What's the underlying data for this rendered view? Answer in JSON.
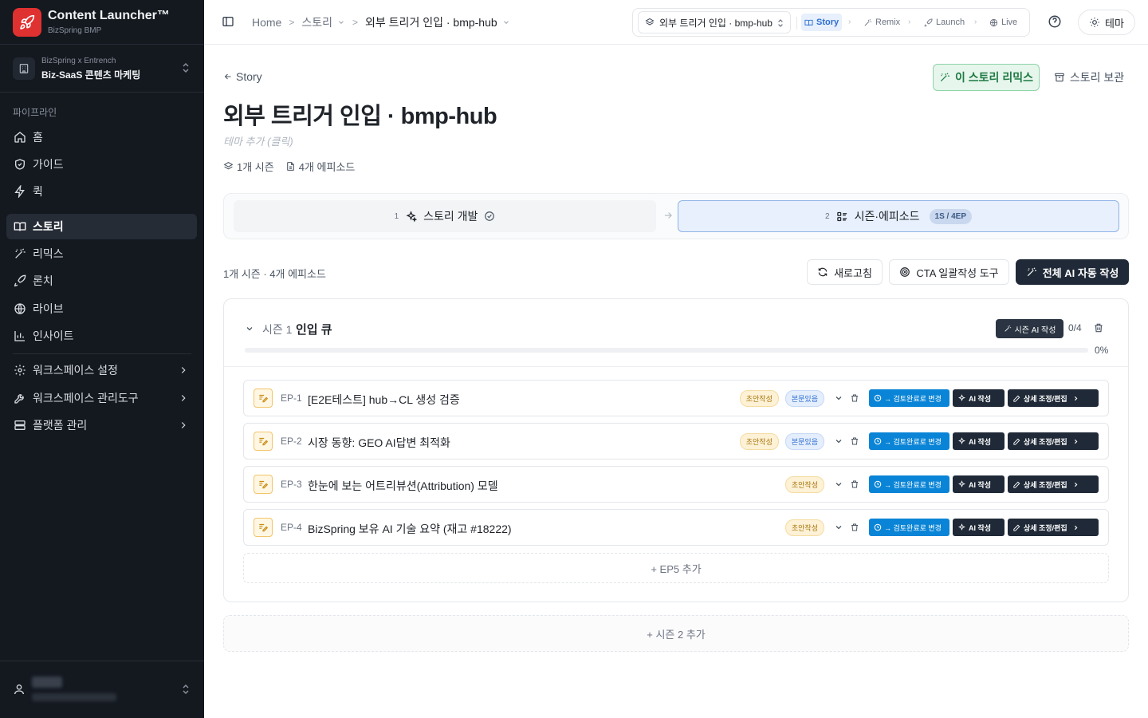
{
  "app": {
    "brand_title": "Content Launcher™",
    "brand_subtitle": "BizSpring BMP"
  },
  "workspace": {
    "label": "BizSpring x Entrench",
    "name": "Biz-SaaS 콘텐츠 마케팅"
  },
  "sidebar": {
    "section_label": "파이프라인",
    "items": [
      {
        "label": "홈",
        "icon": "home-icon"
      },
      {
        "label": "가이드",
        "icon": "shield-icon"
      },
      {
        "label": "퀵",
        "icon": "zap-icon"
      },
      {
        "label": "스토리",
        "icon": "book-icon",
        "active": true
      },
      {
        "label": "리믹스",
        "icon": "magic-wand-icon"
      },
      {
        "label": "론치",
        "icon": "rocket-icon"
      },
      {
        "label": "라이브",
        "icon": "globe-icon"
      },
      {
        "label": "인사이트",
        "icon": "bar-chart-icon"
      }
    ],
    "settings": [
      {
        "label": "워크스페이스 설정",
        "icon": "gear-icon"
      },
      {
        "label": "워크스페이스 관리도구",
        "icon": "wrench-icon"
      },
      {
        "label": "플랫폼 관리",
        "icon": "server-icon"
      }
    ]
  },
  "header": {
    "breadcrumbs": [
      "Home",
      "스토리",
      "외부 트리거 인입 · bmp-hub"
    ],
    "flow_select": "외부 트리거 인입 · bmp-hub",
    "flow_steps": [
      "Story",
      "Remix",
      "Launch",
      "Live"
    ],
    "active_step": "Story",
    "theme_button": "테마"
  },
  "story": {
    "back_label": "Story",
    "remix_button": "이 스토리 리믹스",
    "archive_button": "스토리 보관",
    "title": "외부 트리거 인입 · bmp-hub",
    "theme_placeholder": "테마 추가 (클릭)",
    "season_count": "1개 시즌",
    "episode_count": "4개 에피소드"
  },
  "stepper": {
    "step1": {
      "number": "1",
      "label": "스토리 개발"
    },
    "step2": {
      "number": "2",
      "label": "시즌·에피소드",
      "badge": "1S / 4EP"
    }
  },
  "toolbar": {
    "summary": "1개 시즌 · 4개 에피소드",
    "refresh": "새로고침",
    "cta_tool": "CTA 일괄작성 도구",
    "auto_write": "전체 AI 자동 작성"
  },
  "season": {
    "label": "시즌 1",
    "name": "인입 큐",
    "ai_button": "시즌 AI 작성",
    "count": "0/4",
    "progress_percent": "0%",
    "progress_value": 0
  },
  "episodes": [
    {
      "code": "EP-1",
      "title": "[E2E테스트] hub→CL 생성 검증",
      "status": "초안작성",
      "body_tag": "본문있음",
      "review_button": "→ 검토완료로 변경",
      "ai_button": "AI 작성",
      "edit_button": "상세 조정/편집"
    },
    {
      "code": "EP-2",
      "title": "시장 동향: GEO AI답변 최적화",
      "status": "초안작성",
      "body_tag": "본문있음",
      "review_button": "→ 검토완료로 변경",
      "ai_button": "AI 작성",
      "edit_button": "상세 조정/편집"
    },
    {
      "code": "EP-3",
      "title": "한눈에 보는 어트리뷰션(Attribution) 모델",
      "status": "초안작성",
      "body_tag": "",
      "review_button": "→ 검토완료로 변경",
      "ai_button": "AI 작성",
      "edit_button": "상세 조정/편집"
    },
    {
      "code": "EP-4",
      "title": "BizSpring 보유 AI 기술 요약 (재고 #18222)",
      "status": "초안작성",
      "body_tag": "",
      "review_button": "→ 검토완료로 변경",
      "ai_button": "AI 작성",
      "edit_button": "상세 조정/편집"
    }
  ],
  "add_episode": "+ EP5 추가",
  "add_season": "+ 시즌 2 추가",
  "colors": {
    "sidebar_bg": "#141920",
    "brand_red": "#e03131",
    "accent_blue": "#0a84d6",
    "remix_green": "#1e7a43",
    "dark_button": "#1f2937"
  }
}
